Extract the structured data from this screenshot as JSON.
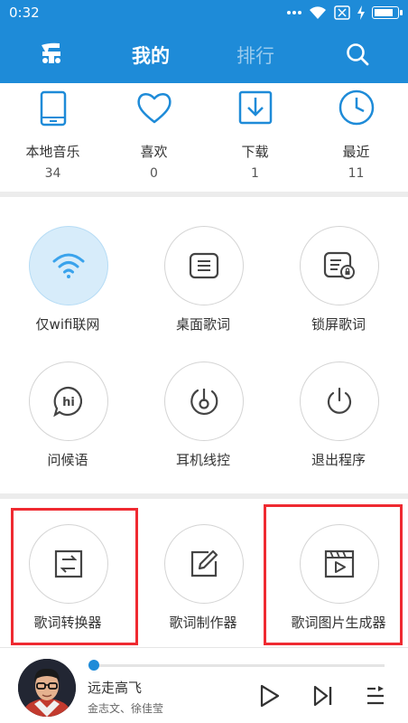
{
  "status_bar": {
    "time": "0:32",
    "icons": [
      "dots-icon",
      "wifi-icon",
      "sim-x-icon",
      "charging-icon",
      "battery-icon"
    ],
    "battery_level": 0.85
  },
  "header": {
    "logo_icon": "music-le-logo",
    "tabs": [
      {
        "label": "我的",
        "active": true
      },
      {
        "label": "排行",
        "active": false
      }
    ],
    "search_icon": "search-icon",
    "color": "#1e8bd8"
  },
  "stats": [
    {
      "icon": "phone-icon",
      "label": "本地音乐",
      "count": "34"
    },
    {
      "icon": "heart-icon",
      "label": "喜欢",
      "count": "0"
    },
    {
      "icon": "download-icon",
      "label": "下载",
      "count": "1"
    },
    {
      "icon": "clock-icon",
      "label": "最近",
      "count": "11"
    }
  ],
  "features": [
    {
      "icon": "wifi-icon",
      "label": "仅wifi联网",
      "active": true
    },
    {
      "icon": "desktop-lyrics-icon",
      "label": "桌面歌词",
      "active": false
    },
    {
      "icon": "lockscreen-lyrics-icon",
      "label": "锁屏歌词",
      "active": false
    },
    {
      "icon": "hi-greeting-icon",
      "label": "问候语",
      "active": false
    },
    {
      "icon": "earphone-control-icon",
      "label": "耳机线控",
      "active": false
    },
    {
      "icon": "power-icon",
      "label": "退出程序",
      "active": false
    }
  ],
  "tools": [
    {
      "icon": "convert-icon",
      "label": "歌词转换器",
      "highlighted": true
    },
    {
      "icon": "edit-icon",
      "label": "歌词制作器",
      "highlighted": false
    },
    {
      "icon": "video-clapper-icon",
      "label": "歌词图片生成器",
      "highlighted": true
    }
  ],
  "player": {
    "song": "远走高飞",
    "artist": "金志文、徐佳莹",
    "progress": 0.01,
    "controls": [
      "play-icon",
      "next-icon",
      "playlist-icon"
    ]
  },
  "colors": {
    "accent": "#1e8bd8",
    "highlight_box": "#ef2a31",
    "active_circle": "#d7ecfa"
  }
}
